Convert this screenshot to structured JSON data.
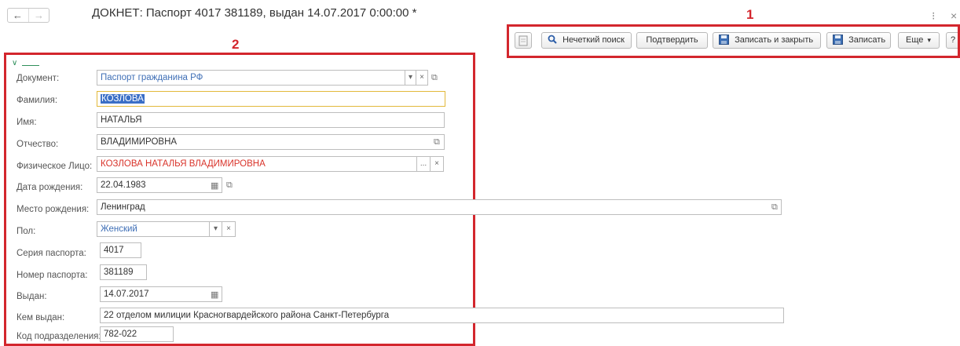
{
  "window": {
    "title": "ДОКНЕТ: Паспорт 4017 381189, выдан 14.07.2017 0:00:00 *",
    "back_glyph": "←",
    "forward_glyph": "→",
    "menu_glyph": "⁝",
    "close_glyph": "×"
  },
  "toolbar": {
    "fuzzy_search_label": "Нечеткий поиск",
    "confirm_label": "Подтвердить",
    "save_close_label": "Записать и закрыть",
    "save_label": "Записать",
    "more_label": "Еще",
    "help_label": "?"
  },
  "annotations": {
    "one": "1",
    "two": "2",
    "color": "#d3262d"
  },
  "form": {
    "document": {
      "label": "Документ:",
      "value": "Паспорт гражданина РФ"
    },
    "surname": {
      "label": "Фамилия:",
      "value": "КОЗЛОВА"
    },
    "name": {
      "label": "Имя:",
      "value": "НАТАЛЬЯ"
    },
    "patronymic": {
      "label": "Отчество:",
      "value": "ВЛАДИМИРОВНА"
    },
    "person": {
      "label": "Физическое Лицо:",
      "value": "КОЗЛОВА НАТАЛЬЯ ВЛАДИМИРОВНА"
    },
    "birth_date": {
      "label": "Дата рождения:",
      "value": "22.04.1983"
    },
    "birth_place": {
      "label": "Место рождения:",
      "value": "Ленинград"
    },
    "sex": {
      "label": "Пол:",
      "value": "Женский"
    },
    "series": {
      "label": "Серия паспорта:",
      "value": "4017"
    },
    "number": {
      "label": "Номер паспорта:",
      "value": "381189"
    },
    "issued": {
      "label": "Выдан:",
      "value": "14.07.2017"
    },
    "issued_by": {
      "label": "Кем выдан:",
      "value": "22 отделом милиции Красногвардейского района Санкт-Петербурга"
    },
    "division_code": {
      "label": "Код подразделения:",
      "value": "782-022"
    }
  },
  "glyphs": {
    "dropdown": "▾",
    "clear": "×",
    "ellipsis": "...",
    "open": "⧉",
    "calendar": "▦"
  },
  "colors": {
    "link": "#3f6fb6",
    "error": "#d9342b",
    "selection": "#3a6ec6",
    "focus_border": "#e2b93b"
  }
}
